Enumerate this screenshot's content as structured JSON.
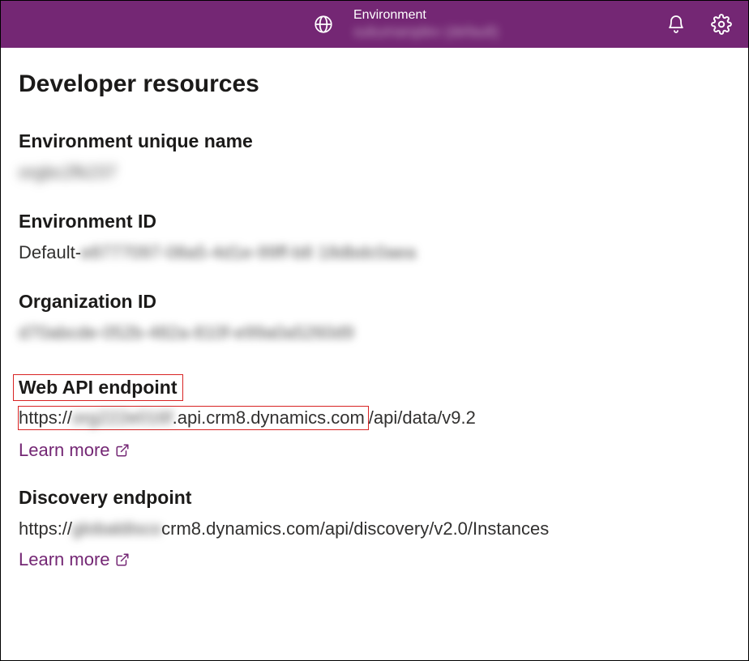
{
  "header": {
    "env_label": "Environment",
    "env_name_blurred": "sukumarqdev (default)"
  },
  "page": {
    "title": "Developer resources"
  },
  "env_unique": {
    "label": "Environment unique name",
    "value_blurred": "orgbc2fk237"
  },
  "env_id": {
    "label": "Environment ID",
    "prefix": "Default-",
    "value_blurred": "e8777097-08a5-4d1e-99ff-b8 18dbdc0aea"
  },
  "org_id": {
    "label": "Organization ID",
    "value_blurred": "d70abcde-052b-482a-810f-e99a0a5260d9"
  },
  "web_api": {
    "label": "Web API endpoint",
    "prefix": "https://",
    "blurred_host": "org222e016f",
    "suffix_in_box": ".api.crm8.dynamics.com",
    "suffix_out": "/api/data/v9.2",
    "learn_more": "Learn more"
  },
  "discovery": {
    "label": "Discovery endpoint",
    "prefix": "https://",
    "blurred_host": "globaldisco",
    "suffix": "crm8.dynamics.com/api/discovery/v2.0/Instances",
    "learn_more": "Learn more"
  }
}
